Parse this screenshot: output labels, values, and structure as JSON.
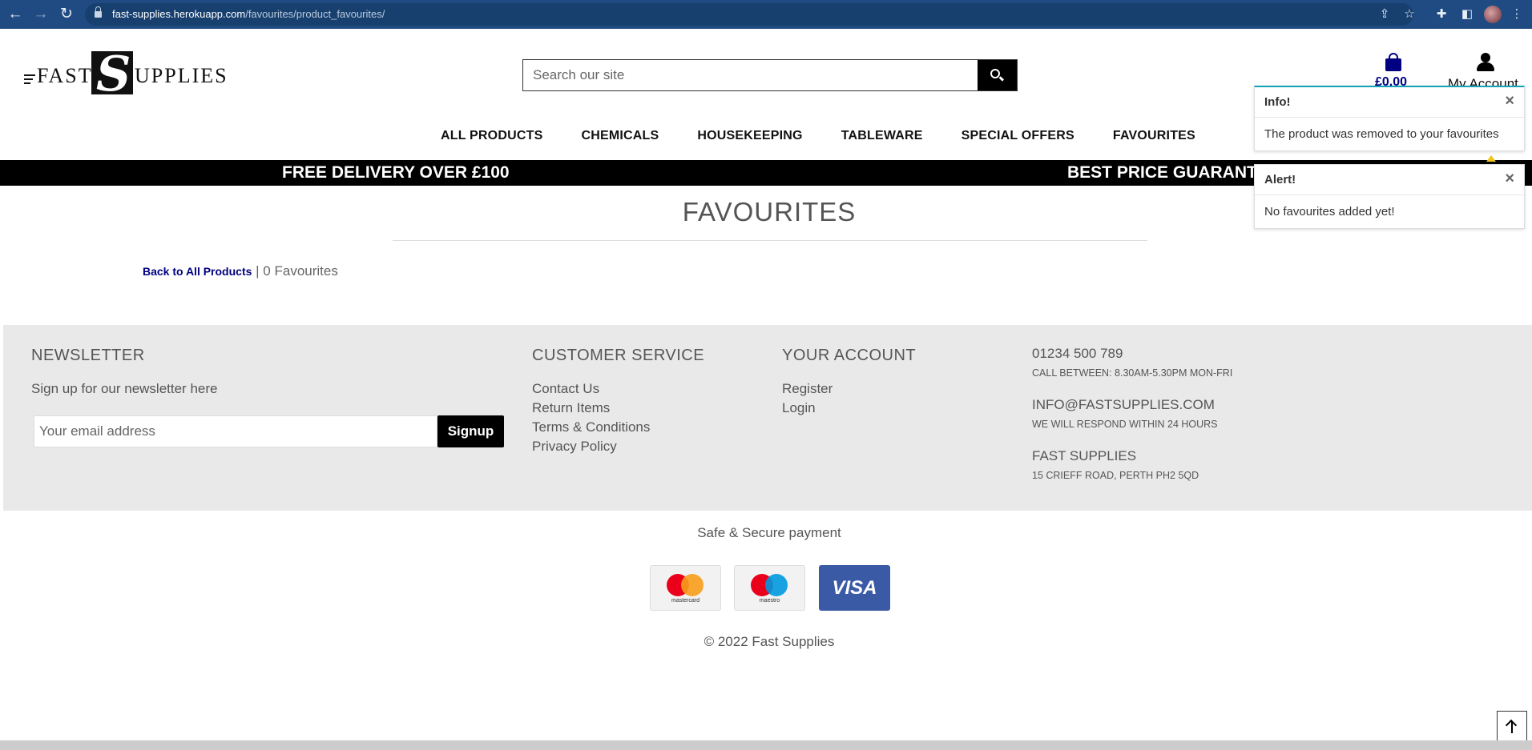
{
  "browser": {
    "url_host": "fast-supplies.herokuapp.com",
    "url_path": "/favourites/product_favourites/"
  },
  "header": {
    "logo_left": "FAST",
    "logo_mark": "S",
    "logo_right": "UPPLIES",
    "search_placeholder": "Search our site",
    "cart_total": "£0.00",
    "account_label": "My Account"
  },
  "nav": {
    "items": [
      "ALL PRODUCTS",
      "CHEMICALS",
      "HOUSEKEEPING",
      "TABLEWARE",
      "SPECIAL OFFERS",
      "FAVOURITES"
    ]
  },
  "promo": {
    "left": "FREE DELIVERY OVER £100",
    "right": "BEST PRICE GUARANTEE"
  },
  "toasts": {
    "info": {
      "title": "Info!",
      "message": "The product was removed to your favourites"
    },
    "alert": {
      "title": "Alert!",
      "message": "No favourites added yet!"
    },
    "accent_info": "#17a2b8",
    "arrow_color": "#f0c419"
  },
  "main": {
    "title": "FAVOURITES",
    "back_link": "Back to All Products",
    "separator": "|",
    "count_text": "0 Favourites"
  },
  "footer": {
    "newsletter": {
      "heading": "NEWSLETTER",
      "text": "Sign up for our newsletter here",
      "email_placeholder": "Your email address",
      "button": "Signup"
    },
    "customer_service": {
      "heading": "CUSTOMER SERVICE",
      "links": [
        "Contact Us",
        "Return Items",
        "Terms & Conditions",
        "Privacy Policy"
      ]
    },
    "account": {
      "heading": "YOUR ACCOUNT",
      "links": [
        "Register",
        "Login"
      ]
    },
    "contact": {
      "phone": "01234 500 789",
      "phone_note": "CALL BETWEEN: 8.30AM-5.30PM MON-FRI",
      "email": "INFO@FASTSUPPLIES.COM",
      "email_note": "WE WILL RESPOND WITHIN 24 HOURS",
      "company": "FAST SUPPLIES",
      "address": "15 CRIEFF ROAD, PERTH PH2 5QD"
    },
    "secure_payment": "Safe & Secure payment",
    "cards": {
      "mastercard": "mastercard",
      "maestro": "maestro",
      "visa": "VISA"
    },
    "copyright": "© 2022 Fast Supplies"
  },
  "colors": {
    "chrome": "#1f4b82",
    "cart_blue": "#000080",
    "footer_bg": "#e9e9e9",
    "visa_blue": "#3a5aa6"
  }
}
